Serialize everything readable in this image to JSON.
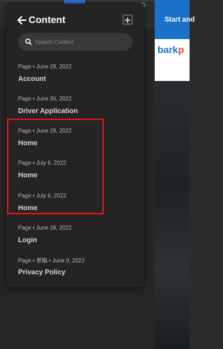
{
  "panel": {
    "title": "Content",
    "search_placeholder": "Search Content",
    "items": [
      {
        "meta": "Page • June 29, 2022",
        "name": "Account"
      },
      {
        "meta": "Page • June 30, 2022",
        "name": "Driver Application"
      },
      {
        "meta": "Page • June 29, 2022",
        "name": "Home"
      },
      {
        "meta": "Page • July 6, 2022",
        "name": "Home"
      },
      {
        "meta": "Page • July 6, 2022",
        "name": "Home"
      },
      {
        "meta": "Page • June 28, 2022",
        "name": "Login"
      },
      {
        "meta": "Page • 草稿 • June 9, 2022",
        "name": "Privacy Policy"
      }
    ]
  },
  "background": {
    "header_text": "Start and",
    "logo_prefix": "bark",
    "logo_suffix": "p"
  },
  "colors": {
    "panel_bg": "#242424",
    "highlight": "#e01818",
    "accent_blue": "#1a73c9"
  }
}
